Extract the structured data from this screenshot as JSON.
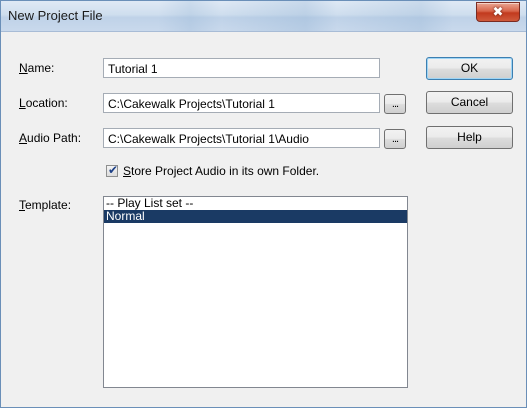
{
  "window": {
    "title": "New Project File",
    "close_glyph": "✖"
  },
  "form": {
    "name": {
      "label": "Name:",
      "mnemonic": "N",
      "rest": "ame:",
      "value": "Tutorial 1"
    },
    "location": {
      "label": "Location:",
      "mnemonic": "L",
      "rest": "ocation:",
      "value": "C:\\Cakewalk Projects\\Tutorial 1",
      "browse_label": "..."
    },
    "audio_path": {
      "label": "Audio Path:",
      "mnemonic": "A",
      "rest": "udio Path:",
      "value": "C:\\Cakewalk Projects\\Tutorial 1\\Audio",
      "browse_label": "..."
    },
    "store_audio": {
      "label": "Store Project Audio in its own Folder.",
      "mnemonic": "S",
      "rest": "tore Project Audio in its own Folder.",
      "checked": true,
      "check_glyph": "✔"
    },
    "template": {
      "label": "Template:",
      "mnemonic": "T",
      "rest": "emplate:",
      "items": [
        "-- Play List set --",
        "Normal"
      ],
      "selected": "Normal"
    }
  },
  "buttons": {
    "ok": "OK",
    "cancel": "Cancel",
    "help": "Help"
  }
}
